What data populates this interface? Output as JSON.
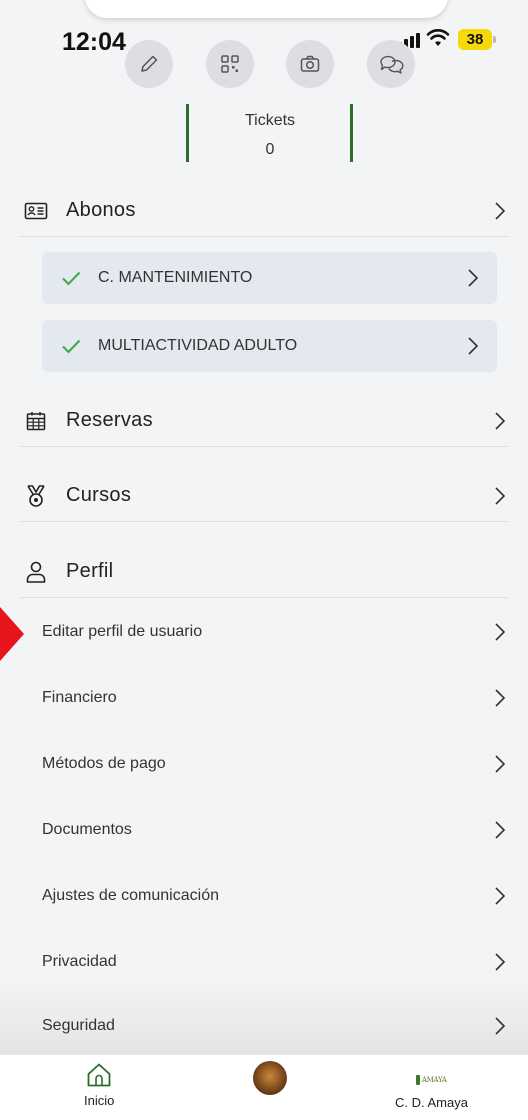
{
  "status_bar": {
    "time": "12:04",
    "battery": "38"
  },
  "quick_actions": [
    "edit-pencil-icon",
    "qr-code-icon",
    "camera-icon",
    "chat-icon"
  ],
  "tickets": {
    "label": "Tickets",
    "value": "0"
  },
  "sections": {
    "abonos": {
      "label": "Abonos",
      "items": [
        {
          "label": "C. MANTENIMIENTO",
          "status": "active"
        },
        {
          "label": "MULTIACTIVIDAD ADULTO",
          "status": "active"
        }
      ]
    },
    "reservas": {
      "label": "Reservas"
    },
    "cursos": {
      "label": "Cursos"
    },
    "perfil": {
      "label": "Perfil",
      "items": [
        {
          "label": "Editar perfil de usuario"
        },
        {
          "label": "Financiero"
        },
        {
          "label": "Métodos de pago"
        },
        {
          "label": "Documentos"
        },
        {
          "label": "Ajustes de comunicación"
        },
        {
          "label": "Privacidad"
        },
        {
          "label": "Seguridad"
        }
      ]
    }
  },
  "tabbar": {
    "items": [
      {
        "label": "Inicio",
        "icon": "home-icon"
      },
      {
        "label": "",
        "icon": "avatar"
      },
      {
        "label": "C. D. Amaya",
        "icon": "club-logo"
      }
    ],
    "club_logo_text": "AMAYA"
  },
  "colors": {
    "accent_green": "#2e6b2e",
    "check_green": "#3aa845",
    "card_bg": "#e4e8ef",
    "annotation_red": "#e8141b"
  }
}
